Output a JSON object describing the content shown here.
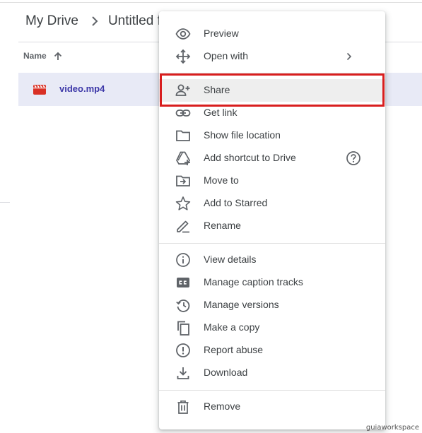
{
  "breadcrumb": {
    "root": "My Drive",
    "current": "Untitled fo"
  },
  "file_list": {
    "column_name": "Name",
    "sort_direction": "ascending",
    "files": [
      {
        "name": "video.mp4",
        "type": "video",
        "icon_color": "#d93025"
      }
    ]
  },
  "context_menu": {
    "groups": [
      [
        {
          "label": "Preview",
          "icon": "eye-icon"
        },
        {
          "label": "Open with",
          "icon": "move-arrows-icon",
          "submenu": true
        }
      ],
      [
        {
          "label": "Share",
          "icon": "person-add-icon",
          "highlighted": true
        },
        {
          "label": "Get link",
          "icon": "link-icon"
        },
        {
          "label": "Show file location",
          "icon": "folder-icon"
        },
        {
          "label": "Add shortcut to Drive",
          "icon": "drive-shortcut-icon",
          "help": true
        },
        {
          "label": "Move to",
          "icon": "folder-move-icon"
        },
        {
          "label": "Add to Starred",
          "icon": "star-icon"
        },
        {
          "label": "Rename",
          "icon": "pencil-icon"
        }
      ],
      [
        {
          "label": "View details",
          "icon": "info-icon"
        },
        {
          "label": "Manage caption tracks",
          "icon": "closed-caption-icon"
        },
        {
          "label": "Manage versions",
          "icon": "history-icon"
        },
        {
          "label": "Make a copy",
          "icon": "copy-icon"
        },
        {
          "label": "Report abuse",
          "icon": "report-icon"
        },
        {
          "label": "Download",
          "icon": "download-icon"
        }
      ],
      [
        {
          "label": "Remove",
          "icon": "trash-icon"
        }
      ]
    ]
  },
  "colors": {
    "highlight_border": "#d81e1e",
    "selected_row": "#e8eaf6",
    "file_name": "#3c37a8",
    "icon_gray": "#5f6368"
  },
  "watermark": "guiaworkspace"
}
